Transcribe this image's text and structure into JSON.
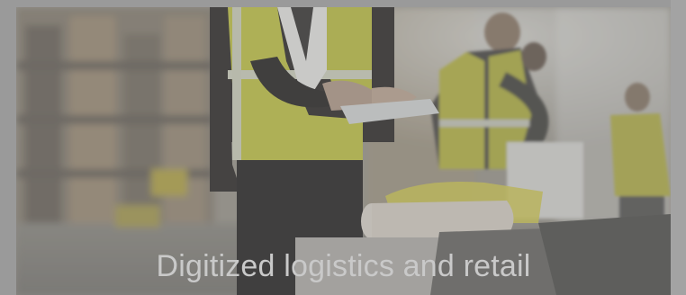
{
  "card": {
    "caption": "Digitized logistics and retail"
  }
}
